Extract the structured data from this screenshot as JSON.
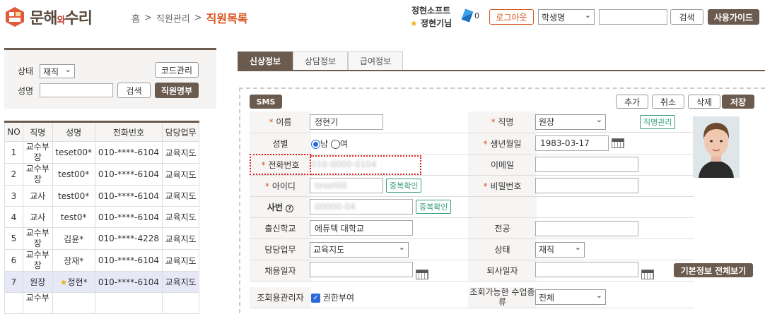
{
  "header": {
    "logo_main": "문해",
    "logo_small": "와",
    "logo_end": "수리",
    "breadcrumb": [
      "홈",
      ">",
      "직원관리",
      ">",
      "직원목록"
    ],
    "company": "정현소프트",
    "user": "정현기님",
    "notif_count": "0",
    "logout_label": "로그아웃",
    "search_type": "학생명",
    "search_value": "",
    "search_label": "검색",
    "guide_label": "사용가이드"
  },
  "filter": {
    "status_label": "상태",
    "status_value": "재직",
    "code_button": "코드관리",
    "name_label": "성명",
    "name_value": "",
    "search_button": "검색",
    "roster_button": "직원명부"
  },
  "table": {
    "headers": [
      "NO",
      "직명",
      "성명",
      "전화번호",
      "담당업무"
    ],
    "rows": [
      [
        "1",
        "교수부장",
        "teset00*",
        "010-****-6104",
        "교육지도"
      ],
      [
        "2",
        "교수부장",
        "test00*",
        "010-****-6104",
        "교육지도"
      ],
      [
        "3",
        "교사",
        "test00*",
        "010-****-6104",
        "교육지도"
      ],
      [
        "4",
        "교사",
        "test0*",
        "010-****-6104",
        "교육지도"
      ],
      [
        "5",
        "교수부장",
        "김윤*",
        "010-****-4228",
        "교육지도"
      ],
      [
        "6",
        "교수부장",
        "장재*",
        "010-****-6104",
        "교육지도"
      ],
      [
        "7",
        "원장",
        "정현*",
        "010-****-6104",
        "교육지도"
      ],
      [
        "",
        "교수부",
        "",
        "",
        ""
      ]
    ]
  },
  "tabs": [
    "신상정보",
    "상담정보",
    "급여정보"
  ],
  "toolbar": {
    "sms": "SMS",
    "add": "추가",
    "cancel": "취소",
    "delete": "삭제",
    "save": "저장"
  },
  "form": {
    "name_label": "이름",
    "name_value": "정현기",
    "position_label": "직명",
    "position_value": "원장",
    "position_btn": "직명관리",
    "gender_label": "성별",
    "gender_m": "남",
    "gender_f": "여",
    "birth_label": "생년월일",
    "birth_value": "1983-03-17",
    "phone_label": "전화번호",
    "phone_value": "010-0000-0104",
    "email_label": "이메일",
    "email_value": "",
    "id_label": "아이디",
    "id_value": "teset00",
    "dup_btn": "중복확인",
    "pw_label": "비밀번호",
    "pw_value": "",
    "empno_label": "사번",
    "empno_value": "00000-04",
    "dup_btn2": "중복확인",
    "school_label": "출신학교",
    "school_value": "에듀텍 대학교",
    "major_label": "전공",
    "major_value": "",
    "duty_label": "담당업무",
    "duty_value": "교육지도",
    "state_label": "상태",
    "state_value": "재직",
    "hire_label": "채용일자",
    "hire_value": "",
    "leave_label": "퇴사일자",
    "leave_value": "",
    "basic_btn": "기본정보 전체보기",
    "admin_label": "조회용관리자",
    "admin_value": "권한부여",
    "course_label": "조회가능한 수업종류",
    "course_value": "전체"
  }
}
